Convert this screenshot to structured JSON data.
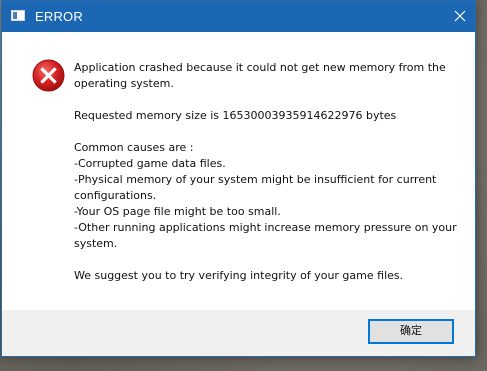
{
  "window": {
    "title": "ERROR",
    "close_icon": "close-icon",
    "accent_color": "#1c67b4"
  },
  "dialog": {
    "icon": "error-icon",
    "message": "Application crashed because it could not get new memory from the\noperating system.\n\nRequested memory size is 16530003935914622976 bytes\n\nCommon causes are :\n-Corrupted game data files.\n-Physical memory of your system might be insufficient for current\nconfigurations.\n-Your OS page file might be too small.\n-Other running applications might increase memory pressure on your\nsystem.\n\nWe suggest you to try verifying integrity of your game files."
  },
  "buttons": {
    "ok_label": "确定"
  }
}
